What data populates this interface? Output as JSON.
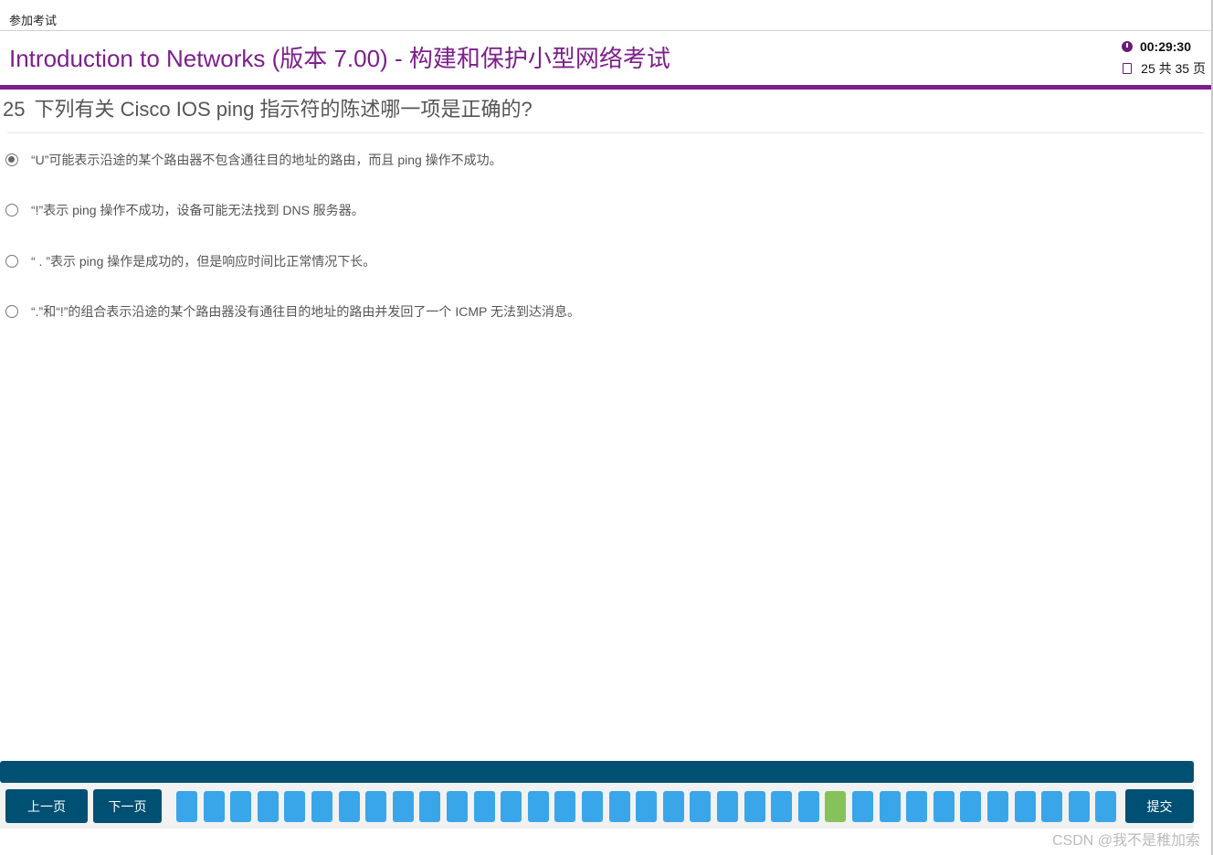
{
  "breadcrumb": "参加考试",
  "header": {
    "title": "Introduction to Networks (版本 7.00) - 构建和保护小型网络考试",
    "timer": "00:29:30",
    "page_indicator": "25 共 35 页"
  },
  "question": {
    "number": "25",
    "text": "下列有关 Cisco IOS ping 指示符的陈述哪一项是正确的?",
    "options": [
      {
        "label": "“U”可能表示沿途的某个路由器不包含通往目的地址的路由，而且 ping 操作不成功。",
        "selected": true
      },
      {
        "label": "“!”表示 ping 操作不成功，设备可能无法找到 DNS 服务器。",
        "selected": false
      },
      {
        "label": "“ . ”表示 ping 操作是成功的，但是响应时间比正常情况下长。",
        "selected": false
      },
      {
        "label": "“.”和“!”的组合表示沿途的某个路由器没有通往目的地址的路由并发回了一个 ICMP 无法到达消息。",
        "selected": false
      }
    ]
  },
  "nav": {
    "prev_label": "上一页",
    "next_label": "下一页",
    "submit_label": "提交",
    "total_questions": 35,
    "current_question": 25
  },
  "watermark": "CSDN @我不是稚加索",
  "colors": {
    "brand_purple": "#7d1f8c",
    "nav_dark": "#005073",
    "question_box": "#3aa6ea",
    "question_current": "#86c25a"
  }
}
